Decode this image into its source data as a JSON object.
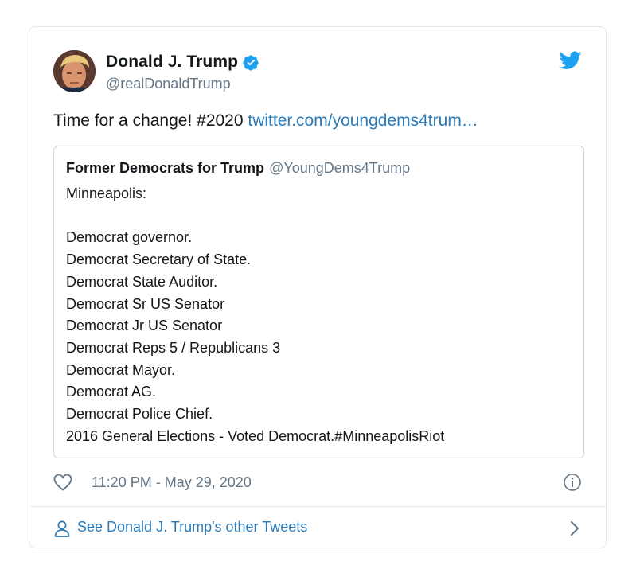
{
  "author": {
    "display_name": "Donald J. Trump",
    "handle": "@realDonaldTrump",
    "verified": true
  },
  "tweet": {
    "text": "Time for a change! #2020 ",
    "link_text": "twitter.com/youngdems4trum…"
  },
  "quote": {
    "display_name": "Former Democrats for Trump",
    "handle": "@YoungDems4Trump",
    "lines": [
      "Minneapolis:",
      "",
      "Democrat governor.",
      "Democrat Secretary of State.",
      "Democrat State Auditor.",
      "Democrat Sr US Senator",
      "Democrat Jr US Senator",
      "Democrat Reps 5 / Republicans 3",
      "Democrat Mayor.",
      "Democrat AG.",
      "Democrat Police Chief.",
      "2016 General Elections - Voted Democrat.#MinneapolisRiot"
    ]
  },
  "meta": {
    "timestamp": "11:20 PM - May 29, 2020"
  },
  "footer": {
    "label": "See Donald J. Trump's other Tweets"
  },
  "icons": {
    "verified": "verified-badge-icon",
    "bird": "twitter-bird-icon",
    "like": "heart-icon",
    "info": "info-icon",
    "person": "person-icon",
    "chevron": "chevron-right-icon"
  },
  "colors": {
    "twitter_blue": "#1da1f2",
    "link": "#2b7bb9",
    "secondary_text": "#657786",
    "border": "#e1e8ed"
  }
}
